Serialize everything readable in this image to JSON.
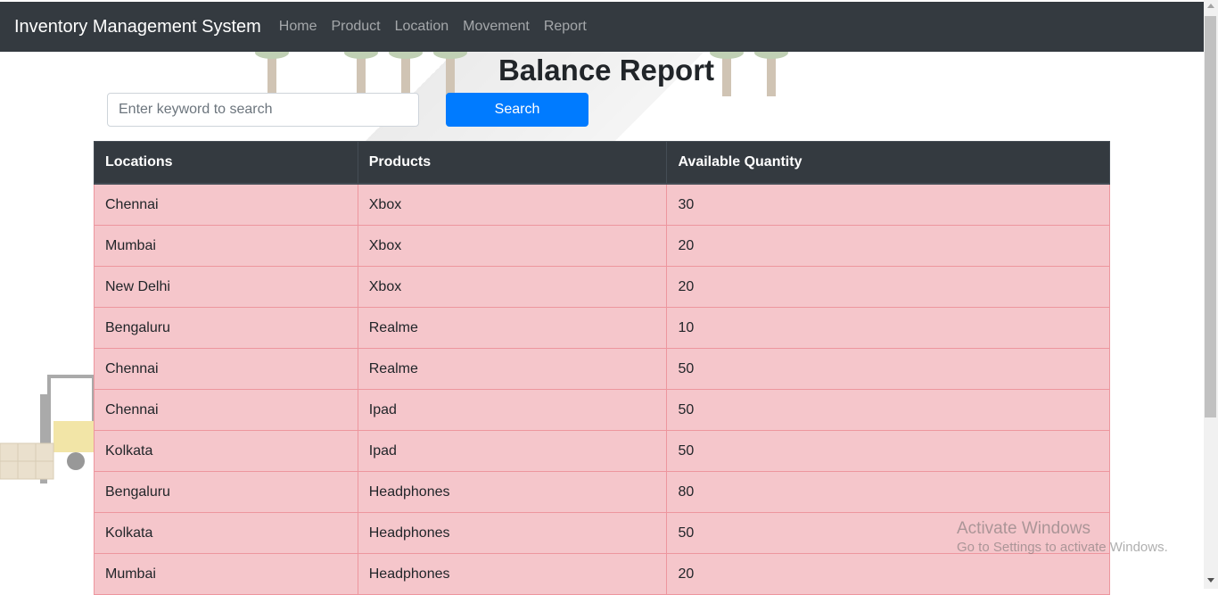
{
  "navbar": {
    "brand": "Inventory Management System",
    "links": [
      "Home",
      "Product",
      "Location",
      "Movement",
      "Report"
    ]
  },
  "page": {
    "title": "Balance Report"
  },
  "search": {
    "placeholder": "Enter keyword to search",
    "value": "",
    "button_label": "Search"
  },
  "table": {
    "headers": [
      "Locations",
      "Products",
      "Available Quantity"
    ],
    "rows": [
      [
        "Chennai",
        "Xbox",
        "30"
      ],
      [
        "Mumbai",
        "Xbox",
        "20"
      ],
      [
        "New Delhi",
        "Xbox",
        "20"
      ],
      [
        "Bengaluru",
        "Realme",
        "10"
      ],
      [
        "Chennai",
        "Realme",
        "50"
      ],
      [
        "Chennai",
        "Ipad",
        "50"
      ],
      [
        "Kolkata",
        "Ipad",
        "50"
      ],
      [
        "Bengaluru",
        "Headphones",
        "80"
      ],
      [
        "Kolkata",
        "Headphones",
        "50"
      ],
      [
        "Mumbai",
        "Headphones",
        "20"
      ]
    ]
  },
  "watermark": {
    "line1": "Activate Windows",
    "line2": "Go to Settings to activate Windows."
  },
  "colors": {
    "navbar": "#343a40",
    "primary": "#007bff",
    "row_danger": "#f5c6cb"
  },
  "icons": {
    "background_illustration": "warehouse-illustration",
    "forklift": "forklift-icon"
  }
}
